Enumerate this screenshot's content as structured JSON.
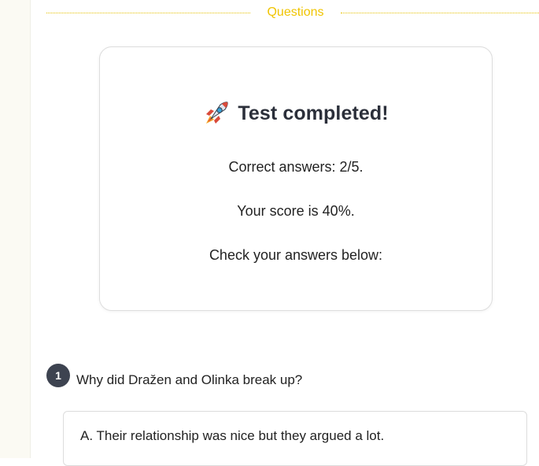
{
  "section": {
    "title": "Questions"
  },
  "result": {
    "icon": "rocket-icon",
    "title": "Test completed!",
    "correct_answers": "Correct answers: 2/5.",
    "score": "Your score is 40%.",
    "check_below": "Check your answers below:"
  },
  "questions": [
    {
      "number": "1",
      "text": "Why did Dražen and Olinka break up?",
      "options": [
        {
          "label": "A. Their relationship was nice but they argued a lot."
        }
      ]
    }
  ],
  "colors": {
    "accent_yellow": "#f0c400",
    "badge_dark": "#3d4350",
    "heading_text": "#2b2f3a"
  }
}
